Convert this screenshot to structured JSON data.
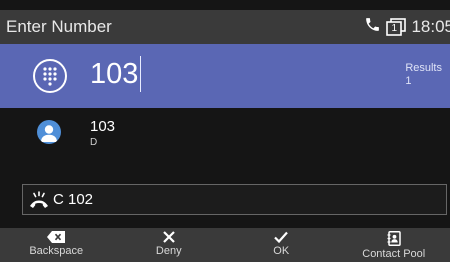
{
  "header": {
    "title": "Enter Number",
    "clock": "18:05",
    "line_indicator": "1"
  },
  "dial": {
    "number": "103",
    "results_label": "Results",
    "results_count": "1"
  },
  "result": {
    "number": "103",
    "sub": "D"
  },
  "active_call": {
    "label": "C 102"
  },
  "softkeys": [
    {
      "label": "Backspace",
      "icon": "backspace-icon"
    },
    {
      "label": "Deny",
      "icon": "x-icon"
    },
    {
      "label": "OK",
      "icon": "check-icon"
    },
    {
      "label": "Contact Pool",
      "icon": "contact-book-icon"
    }
  ],
  "colors": {
    "accent": "#5a67b4",
    "background": "#151515",
    "bar": "#3a3a3a"
  }
}
